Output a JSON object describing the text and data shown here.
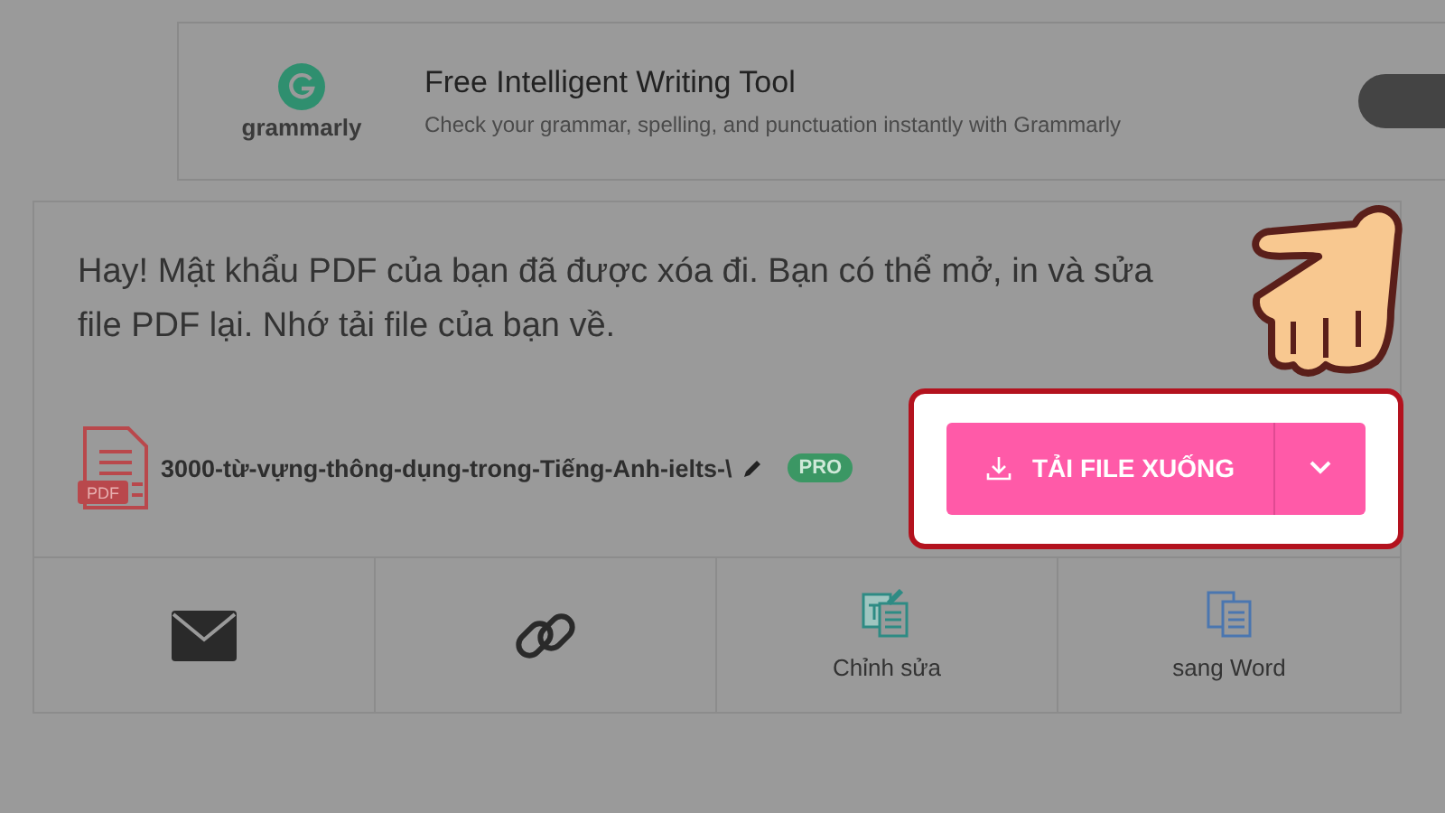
{
  "banner": {
    "brand": "grammarly",
    "title": "Free Intelligent Writing Tool",
    "subtitle": "Check your grammar, spelling, and punctuation instantly with Grammarly"
  },
  "message": "Hay! Mật khẩu PDF của bạn đã được xóa đi. Bạn có thể mở, in và sửa file PDF lại. Nhớ tải file của bạn về.",
  "file": {
    "icon_label": "PDF",
    "name": "3000-từ-vựng-thông-dụng-trong-Tiếng-Anh-ielts-\\",
    "badge": "PRO"
  },
  "download": {
    "label": "TẢI FILE XUỐNG"
  },
  "actions": [
    {
      "kind": "mail"
    },
    {
      "kind": "link"
    },
    {
      "kind": "edit",
      "label": "Chỉnh sửa"
    },
    {
      "kind": "word",
      "label": "sang Word"
    }
  ]
}
